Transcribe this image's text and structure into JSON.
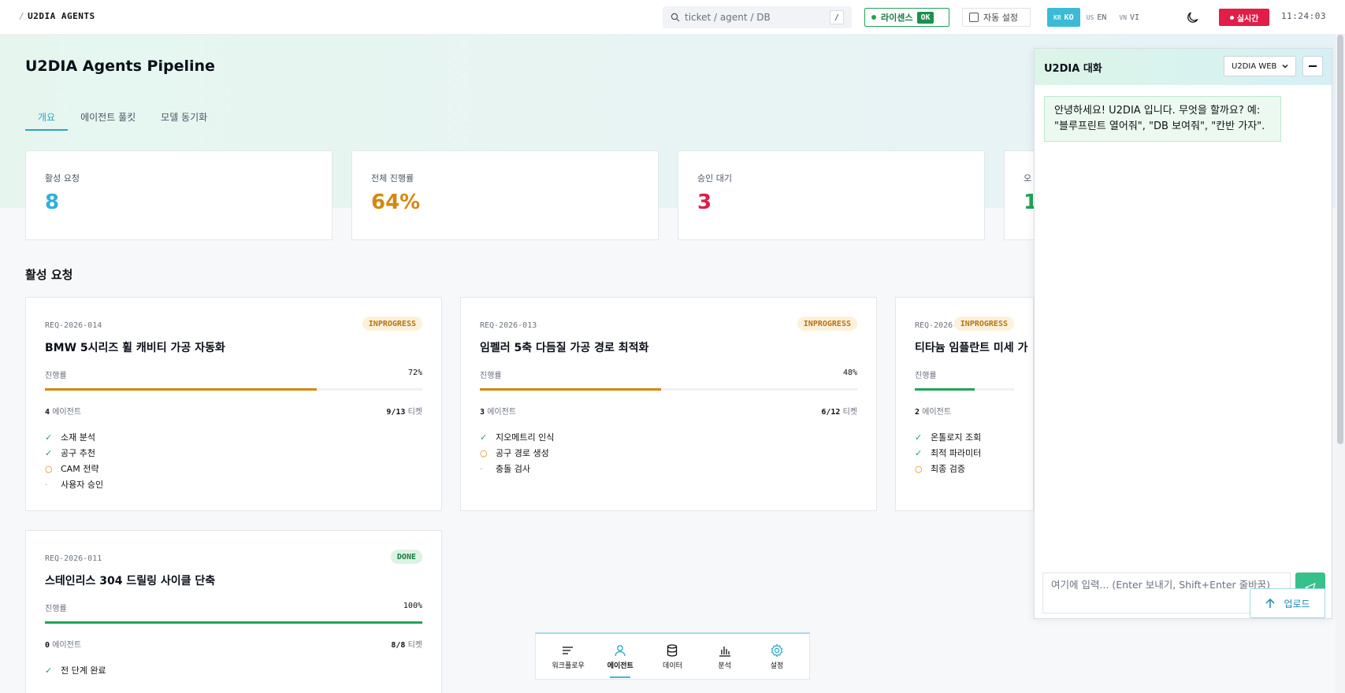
{
  "topbar": {
    "brand": "U2DIA AGENTS",
    "search_placeholder": "ticket / agent / DB",
    "search_shortcut": "/",
    "license_label": "라이센스",
    "license_status": "OK",
    "auto_setting_label": "자동 설정",
    "languages": [
      {
        "code": "KR",
        "label": "KO",
        "active": true
      },
      {
        "code": "US",
        "label": "EN",
        "active": false
      },
      {
        "code": "VN",
        "label": "VI",
        "active": false
      }
    ],
    "live_label": "실시간",
    "clock": "11:24:03"
  },
  "page": {
    "title": "U2DIA Agents Pipeline",
    "tabs": [
      "개요",
      "에이전트 풀킷",
      "모델 동기화"
    ]
  },
  "stats": [
    {
      "label": "활성 요청",
      "value": "8",
      "color": "#2bb1de"
    },
    {
      "label": "전체 진행률",
      "value": "64%",
      "color": "#d4880f"
    },
    {
      "label": "승인 대기",
      "value": "3",
      "color": "#e11d48"
    },
    {
      "label": "오",
      "value": "1",
      "color": "#22a35a"
    }
  ],
  "active_section_title": "활성 요청",
  "progress_label": "진행률",
  "agents_suffix": "에이전트",
  "tickets_suffix": "티켓",
  "requests": [
    {
      "id": "REQ-2026-014",
      "status": "INPROGRESS",
      "title": "BMW 5시리즈 휠 캐비티 가공 자동화",
      "progress": 72,
      "progress_text": "72%",
      "bar_color": "#d4880f",
      "agents": "4",
      "tickets": "9/13",
      "steps": [
        {
          "state": "done",
          "label": "소재 분석"
        },
        {
          "state": "done",
          "label": "공구 추천"
        },
        {
          "state": "prog",
          "label": "CAM 전략"
        },
        {
          "state": "pend",
          "label": "사용자 승인"
        }
      ]
    },
    {
      "id": "REQ-2026-013",
      "status": "INPROGRESS",
      "title": "임펠러 5축 다듬질 가공 경로 최적화",
      "progress": 48,
      "progress_text": "48%",
      "bar_color": "#d4880f",
      "agents": "3",
      "tickets": "6/12",
      "steps": [
        {
          "state": "done",
          "label": "지오메트리 인식"
        },
        {
          "state": "prog",
          "label": "공구 경로 생성"
        },
        {
          "state": "pend",
          "label": "충돌 검사"
        }
      ]
    },
    {
      "id": "REQ-2026-012",
      "status": "INPROGRESS",
      "title": "티타늄 임플란트 미세 가",
      "progress": 60,
      "progress_text": "",
      "bar_color": "#22a35a",
      "agents": "2",
      "tickets": "",
      "steps": [
        {
          "state": "done",
          "label": "온톨로지 조회"
        },
        {
          "state": "done",
          "label": "최적 파라미터"
        },
        {
          "state": "prog",
          "label": "최종 검증"
        }
      ]
    },
    {
      "id": "REQ-2026-011",
      "status": "DONE",
      "title": "스테인리스 304 드릴링 사이클 단축",
      "progress": 100,
      "progress_text": "100%",
      "bar_color": "#22a35a",
      "agents": "0",
      "tickets": "8/8",
      "steps": [
        {
          "state": "done",
          "label": "전 단계 완료"
        }
      ]
    }
  ],
  "step_marks": {
    "done": "✓",
    "prog": "○",
    "pend": "·"
  },
  "bottom_nav": [
    {
      "label": "워크플로우",
      "icon": "workflow-icon",
      "active": false
    },
    {
      "label": "에이전트",
      "icon": "person-icon",
      "active": true
    },
    {
      "label": "데이터",
      "icon": "database-icon",
      "active": false
    },
    {
      "label": "분석",
      "icon": "chart-icon",
      "active": false
    },
    {
      "label": "설정",
      "icon": "gear-icon",
      "active": false
    }
  ],
  "chat": {
    "title": "U2DIA 대화",
    "mode": "U2DIA WEB",
    "greeting": "안녕하세요! U2DIA 입니다. 무엇을 할까요? 예: \"블루프린트 열어줘\", \"DB 보여줘\", \"칸반 가자\".",
    "input_placeholder": "여기에 입력... (Enter 보내기, Shift+Enter 줄바꿈)",
    "upload_label": "업로드"
  }
}
